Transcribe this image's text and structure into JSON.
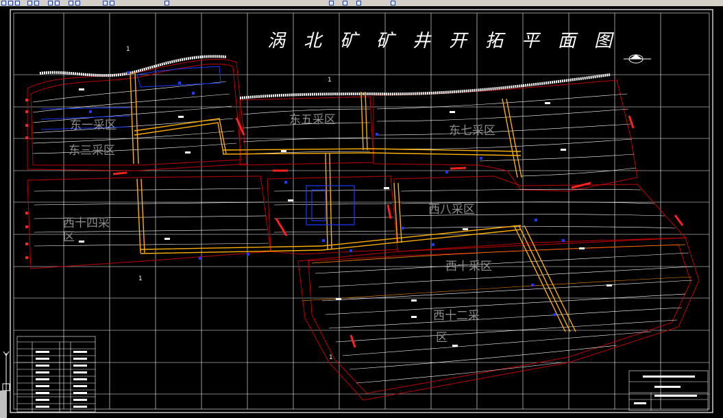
{
  "drawing": {
    "title": "涡北矿矿井开拓平面图"
  },
  "zones": {
    "east1": "东一采区",
    "east3": "东三采区",
    "east5": "东五采区",
    "east7": "东七采区",
    "west14_line1": "西十四采",
    "west14_line2": "区",
    "west8": "西八采区",
    "west10": "西十采区",
    "west12_line1": "西十二采",
    "west12_line2": "区"
  },
  "section_markers": [
    "1",
    "1",
    "1",
    "1"
  ],
  "colors": {
    "background": "#000000",
    "grid": "#ffffff",
    "roadway": "#ffb000",
    "boundary": "#c00000",
    "contour": "#ffffff",
    "boreholes": "#1a3cff",
    "faults": "#ff2020",
    "label": "#8c8c8c"
  },
  "icons": {
    "north_arrow": "north-arrow-icon",
    "ucs": "ucs-axis-icon"
  }
}
